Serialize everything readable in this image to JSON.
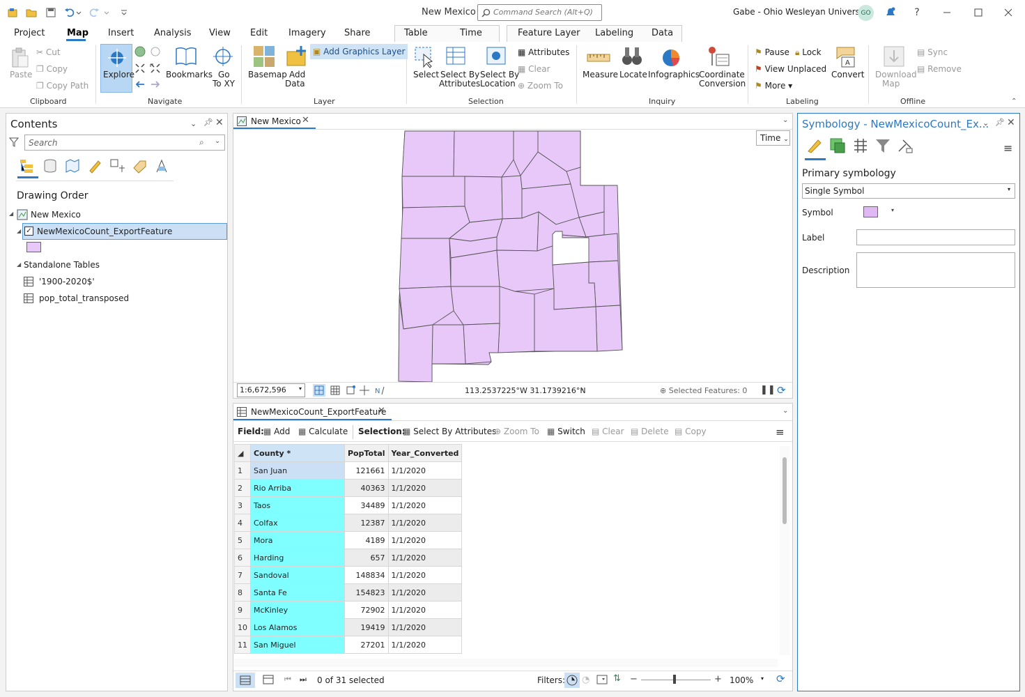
{
  "app": {
    "title": "New Mexico",
    "command_search_placeholder": "Command Search (Alt+Q)",
    "user": "Gabe - Ohio Wesleyan University",
    "avatar_initials": "GO"
  },
  "ribbon_tabs": [
    "Project",
    "Map",
    "Insert",
    "Analysis",
    "View",
    "Edit",
    "Imagery",
    "Share",
    "Table",
    "Time",
    "Feature Layer",
    "Labeling",
    "Data"
  ],
  "ribbon": {
    "clipboard": {
      "paste": "Paste",
      "cut": "Cut",
      "copy": "Copy",
      "copy_path": "Copy Path",
      "group": "Clipboard"
    },
    "navigate": {
      "explore": "Explore",
      "bookmarks": "Bookmarks",
      "goto_line1": "Go",
      "goto_line2": "To XY",
      "group": "Navigate"
    },
    "layer": {
      "basemap": "Basemap",
      "add_line1": "Add",
      "add_line2": "Data",
      "add_graphics": "Add Graphics Layer",
      "group": "Layer"
    },
    "selection": {
      "select": "Select",
      "sba_line1": "Select By",
      "sba_line2": "Attributes",
      "sbl_line1": "Select By",
      "sbl_line2": "Location",
      "attributes": "Attributes",
      "clear": "Clear",
      "zoom_to": "Zoom To",
      "group": "Selection"
    },
    "inquiry": {
      "measure": "Measure",
      "locate": "Locate",
      "infographics": "Infographics",
      "coord_line1": "Coordinate",
      "coord_line2": "Conversion",
      "group": "Inquiry"
    },
    "labeling": {
      "pause": "Pause",
      "lock": "Lock",
      "view_unplaced": "View Unplaced",
      "more": "More",
      "convert": "Convert",
      "group": "Labeling"
    },
    "offline": {
      "download_line1": "Download",
      "download_line2": "Map",
      "sync": "Sync",
      "remove": "Remove",
      "group": "Offline"
    }
  },
  "contents": {
    "title": "Contents",
    "search_placeholder": "Search",
    "drawing_order": "Drawing Order",
    "map_name": "New Mexico",
    "layer_name": "NewMexicoCount_ExportFeature",
    "standalone_tables": "Standalone Tables",
    "tables": [
      "'1900-2020$'",
      "pop_total_transposed"
    ],
    "layer_color": "#e8c8f8"
  },
  "map_view": {
    "tab": "New Mexico",
    "time_button": "Time",
    "scale": "1:6,672,596",
    "coordinates": "113.2537225°W 31.1739216°N",
    "selected_features": "Selected Features: 0",
    "fill_color": "#e8c8f8"
  },
  "attribute_table": {
    "tab": "NewMexicoCount_ExportFeature",
    "field_label": "Field:",
    "add": "Add",
    "calculate": "Calculate",
    "selection_label": "Selection:",
    "select_by_attributes": "Select By Attributes",
    "zoom_to": "Zoom To",
    "switch": "Switch",
    "clear": "Clear",
    "delete": "Delete",
    "copy": "Copy",
    "columns": [
      "County *",
      "PopTotal",
      "Year_Converted"
    ],
    "rows": [
      {
        "n": "1",
        "county": "San Juan",
        "pop": "121661",
        "year": "1/1/2020"
      },
      {
        "n": "2",
        "county": "Rio Arriba",
        "pop": "40363",
        "year": "1/1/2020"
      },
      {
        "n": "3",
        "county": "Taos",
        "pop": "34489",
        "year": "1/1/2020"
      },
      {
        "n": "4",
        "county": "Colfax",
        "pop": "12387",
        "year": "1/1/2020"
      },
      {
        "n": "5",
        "county": "Mora",
        "pop": "4189",
        "year": "1/1/2020"
      },
      {
        "n": "6",
        "county": "Harding",
        "pop": "657",
        "year": "1/1/2020"
      },
      {
        "n": "7",
        "county": "Sandoval",
        "pop": "148834",
        "year": "1/1/2020"
      },
      {
        "n": "8",
        "county": "Santa Fe",
        "pop": "154823",
        "year": "1/1/2020"
      },
      {
        "n": "9",
        "county": "McKinley",
        "pop": "72902",
        "year": "1/1/2020"
      },
      {
        "n": "10",
        "county": "Los Alamos",
        "pop": "19419",
        "year": "1/1/2020"
      },
      {
        "n": "11",
        "county": "San Miguel",
        "pop": "27201",
        "year": "1/1/2020"
      }
    ],
    "status": "0 of 31 selected",
    "filters_label": "Filters:",
    "zoom_level": "100%",
    "highlight_color": "#7fffff"
  },
  "symbology": {
    "title": "Symbology - NewMexicoCount_Ex...",
    "primary": "Primary symbology",
    "type": "Single Symbol",
    "symbol_label": "Symbol",
    "label_label": "Label",
    "description_label": "Description",
    "label_value": "",
    "description_value": "",
    "symbol_color": "#e0b8f4"
  }
}
